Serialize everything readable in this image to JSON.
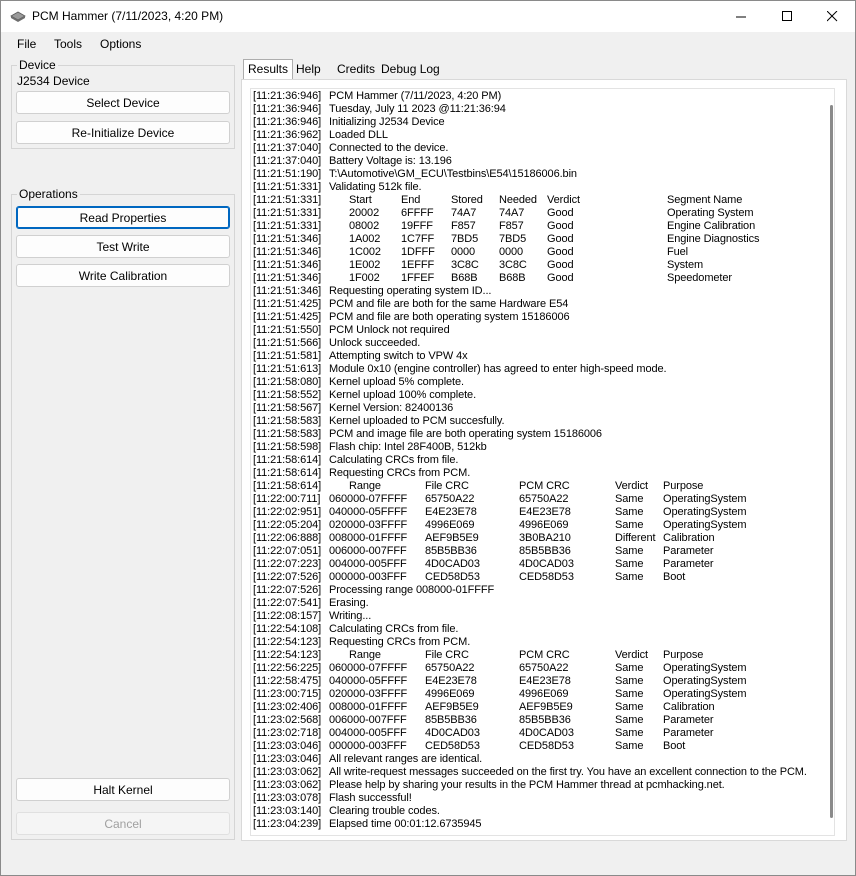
{
  "window": {
    "title": "PCM Hammer (7/11/2023, 4:20 PM)",
    "icon": "hammer-app-icon"
  },
  "menu": {
    "file": "File",
    "tools": "Tools",
    "options": "Options"
  },
  "device": {
    "group_label": "Device",
    "name": "J2534 Device",
    "select_button": "Select Device",
    "reinit_button": "Re-Initialize Device"
  },
  "operations": {
    "group_label": "Operations",
    "read_button": "Read Properties",
    "test_button": "Test Write",
    "write_button": "Write Calibration"
  },
  "bottom": {
    "halt_button": "Halt Kernel",
    "cancel_button": "Cancel"
  },
  "tabs": [
    {
      "label": "Results"
    },
    {
      "label": "Help"
    },
    {
      "label": "Credits"
    },
    {
      "label": "Debug Log"
    }
  ],
  "log": [
    {
      "t": "[11:21:36:946]",
      "m": "PCM Hammer (7/11/2023, 4:20 PM)"
    },
    {
      "t": "[11:21:36:946]",
      "m": "Tuesday, July 11 2023 @11:21:36:94"
    },
    {
      "t": "[11:21:36:946]",
      "m": "Initializing J2534 Device"
    },
    {
      "t": "[11:21:36:962]",
      "m": "Loaded DLL"
    },
    {
      "t": "[11:21:37:040]",
      "m": "Connected to the device."
    },
    {
      "t": "[11:21:37:040]",
      "m": "Battery Voltage is: 13.196"
    },
    {
      "t": "[11:21:51:190]",
      "m": "T:\\Automotive\\GM_ECU\\Testbins\\E54\\15186006.bin"
    },
    {
      "t": "[11:21:51:331]",
      "m": "Validating 512k file."
    },
    {
      "t": "[11:21:51:331]",
      "cols": [
        "Start",
        "End",
        "Stored",
        "Needed",
        "Verdict",
        "Segment Name"
      ]
    },
    {
      "t": "[11:21:51:331]",
      "cols": [
        "20002",
        "6FFFF",
        "74A7",
        "74A7",
        "Good",
        "Operating System"
      ]
    },
    {
      "t": "[11:21:51:331]",
      "cols": [
        "08002",
        "19FFF",
        "F857",
        "F857",
        "Good",
        "Engine Calibration"
      ]
    },
    {
      "t": "[11:21:51:346]",
      "cols": [
        "1A002",
        "1C7FF",
        "7BD5",
        "7BD5",
        "Good",
        "Engine Diagnostics"
      ]
    },
    {
      "t": "[11:21:51:346]",
      "cols": [
        "1C002",
        "1DFFF",
        "0000",
        "0000",
        "Good",
        "Fuel"
      ]
    },
    {
      "t": "[11:21:51:346]",
      "cols": [
        "1E002",
        "1EFFF",
        "3C8C",
        "3C8C",
        "Good",
        "System"
      ]
    },
    {
      "t": "[11:21:51:346]",
      "cols": [
        "1F002",
        "1FFEF",
        "B68B",
        "B68B",
        "Good",
        "Speedometer"
      ]
    },
    {
      "t": "[11:21:51:346]",
      "m": "Requesting operating system ID..."
    },
    {
      "t": "[11:21:51:425]",
      "m": "PCM and file are both for the same Hardware E54"
    },
    {
      "t": "[11:21:51:425]",
      "m": "PCM and file are both operating system 15186006"
    },
    {
      "t": "[11:21:51:550]",
      "m": "PCM Unlock not required"
    },
    {
      "t": "[11:21:51:566]",
      "m": "Unlock succeeded."
    },
    {
      "t": "[11:21:51:581]",
      "m": "Attempting switch to VPW 4x"
    },
    {
      "t": "[11:21:51:613]",
      "m": "Module 0x10 (engine controller) has agreed to enter high-speed mode."
    },
    {
      "t": "[11:21:58:080]",
      "m": "Kernel upload 5% complete."
    },
    {
      "t": "[11:21:58:552]",
      "m": "Kernel upload 100% complete."
    },
    {
      "t": "[11:21:58:567]",
      "m": "Kernel Version: 82400136"
    },
    {
      "t": "[11:21:58:583]",
      "m": "Kernel uploaded to PCM succesfully."
    },
    {
      "t": "[11:21:58:583]",
      "m": "PCM and image file are both operating system 15186006"
    },
    {
      "t": "[11:21:58:598]",
      "m": "Flash chip: Intel 28F400B, 512kb"
    },
    {
      "t": "[11:21:58:614]",
      "m": "Calculating CRCs from file."
    },
    {
      "t": "[11:21:58:614]",
      "m": "Requesting CRCs from PCM."
    },
    {
      "t": "[11:21:58:614]",
      "crc": [
        "Range",
        "File CRC",
        "PCM CRC",
        "Verdict",
        "Purpose"
      ],
      "hdr": true
    },
    {
      "t": "[11:22:00:711]",
      "crc": [
        "060000-07FFFF",
        "65750A22",
        "65750A22",
        "Same",
        "OperatingSystem"
      ]
    },
    {
      "t": "[11:22:02:951]",
      "crc": [
        "040000-05FFFF",
        "E4E23E78",
        "E4E23E78",
        "Same",
        "OperatingSystem"
      ]
    },
    {
      "t": "[11:22:05:204]",
      "crc": [
        "020000-03FFFF",
        "4996E069",
        "4996E069",
        "Same",
        "OperatingSystem"
      ]
    },
    {
      "t": "[11:22:06:888]",
      "crc": [
        "008000-01FFFF",
        "AEF9B5E9",
        "3B0BA210",
        "Different",
        "Calibration"
      ]
    },
    {
      "t": "[11:22:07:051]",
      "crc": [
        "006000-007FFF",
        "85B5BB36",
        "85B5BB36",
        "Same",
        "Parameter"
      ]
    },
    {
      "t": "[11:22:07:223]",
      "crc": [
        "004000-005FFF",
        "4D0CAD03",
        "4D0CAD03",
        "Same",
        "Parameter"
      ]
    },
    {
      "t": "[11:22:07:526]",
      "crc": [
        "000000-003FFF",
        "CED58D53",
        "CED58D53",
        "Same",
        "Boot"
      ]
    },
    {
      "t": "[11:22:07:526]",
      "m": "Processing range 008000-01FFFF"
    },
    {
      "t": "[11:22:07:541]",
      "m": "Erasing."
    },
    {
      "t": "[11:22:08:157]",
      "m": "Writing..."
    },
    {
      "t": "[11:22:54:108]",
      "m": "Calculating CRCs from file."
    },
    {
      "t": "[11:22:54:123]",
      "m": "Requesting CRCs from PCM."
    },
    {
      "t": "[11:22:54:123]",
      "crc": [
        "Range",
        "File CRC",
        "PCM CRC",
        "Verdict",
        "Purpose"
      ],
      "hdr": true
    },
    {
      "t": "[11:22:56:225]",
      "crc": [
        "060000-07FFFF",
        "65750A22",
        "65750A22",
        "Same",
        "OperatingSystem"
      ]
    },
    {
      "t": "[11:22:58:475]",
      "crc": [
        "040000-05FFFF",
        "E4E23E78",
        "E4E23E78",
        "Same",
        "OperatingSystem"
      ]
    },
    {
      "t": "[11:23:00:715]",
      "crc": [
        "020000-03FFFF",
        "4996E069",
        "4996E069",
        "Same",
        "OperatingSystem"
      ]
    },
    {
      "t": "[11:23:02:406]",
      "crc": [
        "008000-01FFFF",
        "AEF9B5E9",
        "AEF9B5E9",
        "Same",
        "Calibration"
      ]
    },
    {
      "t": "[11:23:02:568]",
      "crc": [
        "006000-007FFF",
        "85B5BB36",
        "85B5BB36",
        "Same",
        "Parameter"
      ]
    },
    {
      "t": "[11:23:02:718]",
      "crc": [
        "004000-005FFF",
        "4D0CAD03",
        "4D0CAD03",
        "Same",
        "Parameter"
      ]
    },
    {
      "t": "[11:23:03:046]",
      "crc": [
        "000000-003FFF",
        "CED58D53",
        "CED58D53",
        "Same",
        "Boot"
      ]
    },
    {
      "t": "[11:23:03:046]",
      "m": "All relevant ranges are identical."
    },
    {
      "t": "[11:23:03:062]",
      "m": "All write-request messages succeeded on the first try. You have an excellent connection to the PCM."
    },
    {
      "t": "[11:23:03:062]",
      "m": "Please help by sharing your results in the PCM Hammer thread at pcmhacking.net."
    },
    {
      "t": "[11:23:03:078]",
      "m": "Flash successful!"
    },
    {
      "t": "[11:23:03:140]",
      "m": "Clearing trouble codes."
    },
    {
      "t": "[11:23:04:239]",
      "m": "Elapsed time 00:01:12.6735945"
    }
  ]
}
